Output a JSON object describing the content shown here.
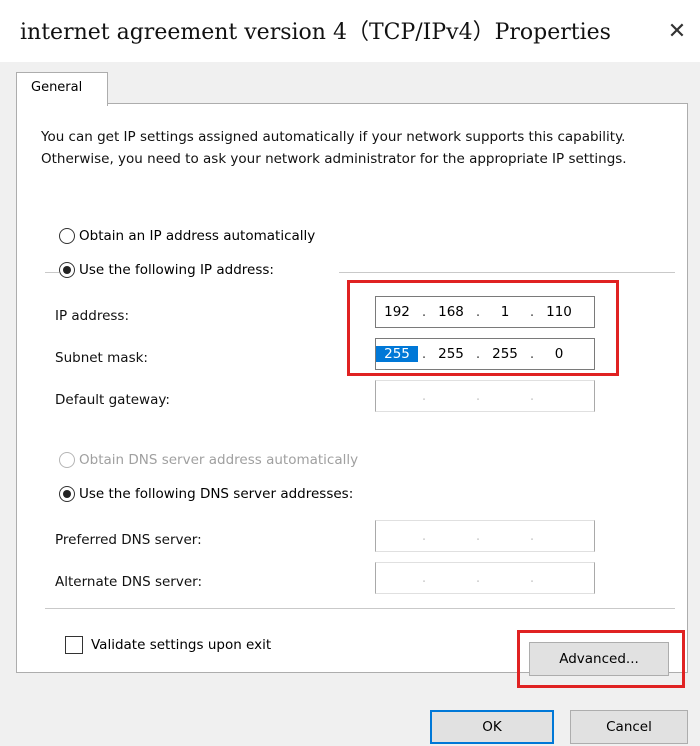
{
  "window": {
    "title": "internet agreement version 4（TCP/IPv4）Properties",
    "close_glyph": "✕"
  },
  "tabs": [
    {
      "label": "General",
      "selected": true
    }
  ],
  "intro_text": "You can get IP settings assigned automatically if your network supports this capability. Otherwise, you need to ask your network administrator for the appropriate IP settings.",
  "ip_mode": {
    "auto": {
      "label": "Obtain an IP address automatically",
      "checked": false
    },
    "manual": {
      "label": "Use the following IP address:",
      "checked": true
    }
  },
  "ip_fields": {
    "ip_address": {
      "label": "IP address:",
      "octets": [
        "192",
        "168",
        "1",
        "110"
      ]
    },
    "subnet_mask": {
      "label": "Subnet mask:",
      "octets": [
        "255",
        "255",
        "255",
        "0"
      ],
      "selected_octet": 0
    },
    "default_gateway": {
      "label": "Default gateway:",
      "octets": [
        "",
        "",
        "",
        ""
      ]
    }
  },
  "dns_mode": {
    "auto": {
      "label": "Obtain DNS server address automatically",
      "checked": false,
      "disabled": true
    },
    "manual": {
      "label": "Use the following DNS server addresses:",
      "checked": true
    }
  },
  "dns_fields": {
    "preferred": {
      "label": "Preferred DNS server:",
      "octets": [
        "",
        "",
        "",
        ""
      ]
    },
    "alternate": {
      "label": "Alternate DNS server:",
      "octets": [
        "",
        "",
        "",
        ""
      ]
    }
  },
  "validate": {
    "label": "Validate settings upon exit",
    "checked": false
  },
  "buttons": {
    "advanced": "Advanced...",
    "ok": "OK",
    "cancel": "Cancel"
  },
  "colors": {
    "highlight": "#e02222",
    "accent": "#0078d7"
  }
}
